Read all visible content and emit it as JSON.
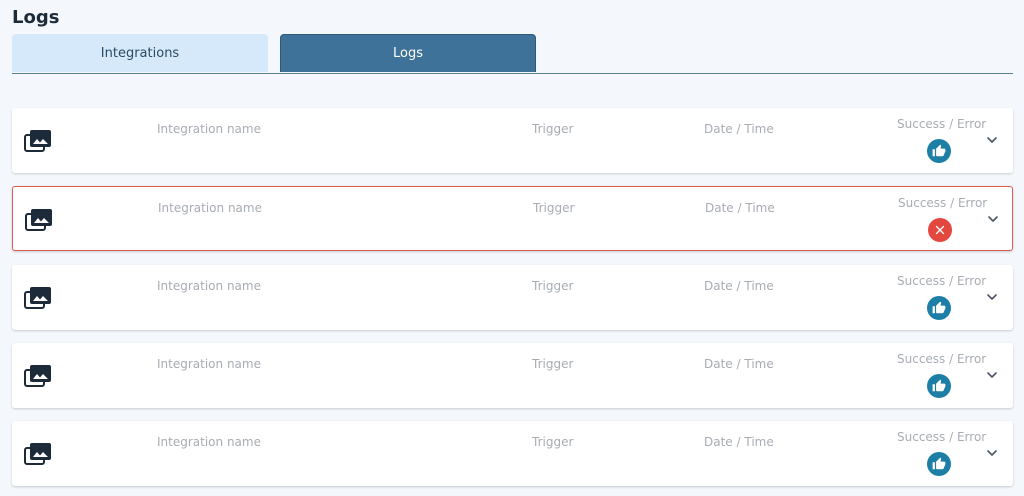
{
  "page": {
    "title": "Logs"
  },
  "tabs": [
    {
      "label": "Integrations",
      "active": false
    },
    {
      "label": "Logs",
      "active": true
    }
  ],
  "columns": {
    "name": "Integration name",
    "trigger": "Trigger",
    "date": "Date / Time",
    "status": "Success / Error"
  },
  "rows": [
    {
      "status": "success",
      "icon": "photo-library-icon"
    },
    {
      "status": "error",
      "icon": "photo-library-icon"
    },
    {
      "status": "success",
      "icon": "photo-library-icon"
    },
    {
      "status": "success",
      "icon": "photo-library-icon"
    },
    {
      "status": "success",
      "icon": "photo-library-icon"
    }
  ],
  "colors": {
    "accent": "#3f7299",
    "success": "#1d7fa6",
    "error": "#e4473e"
  }
}
